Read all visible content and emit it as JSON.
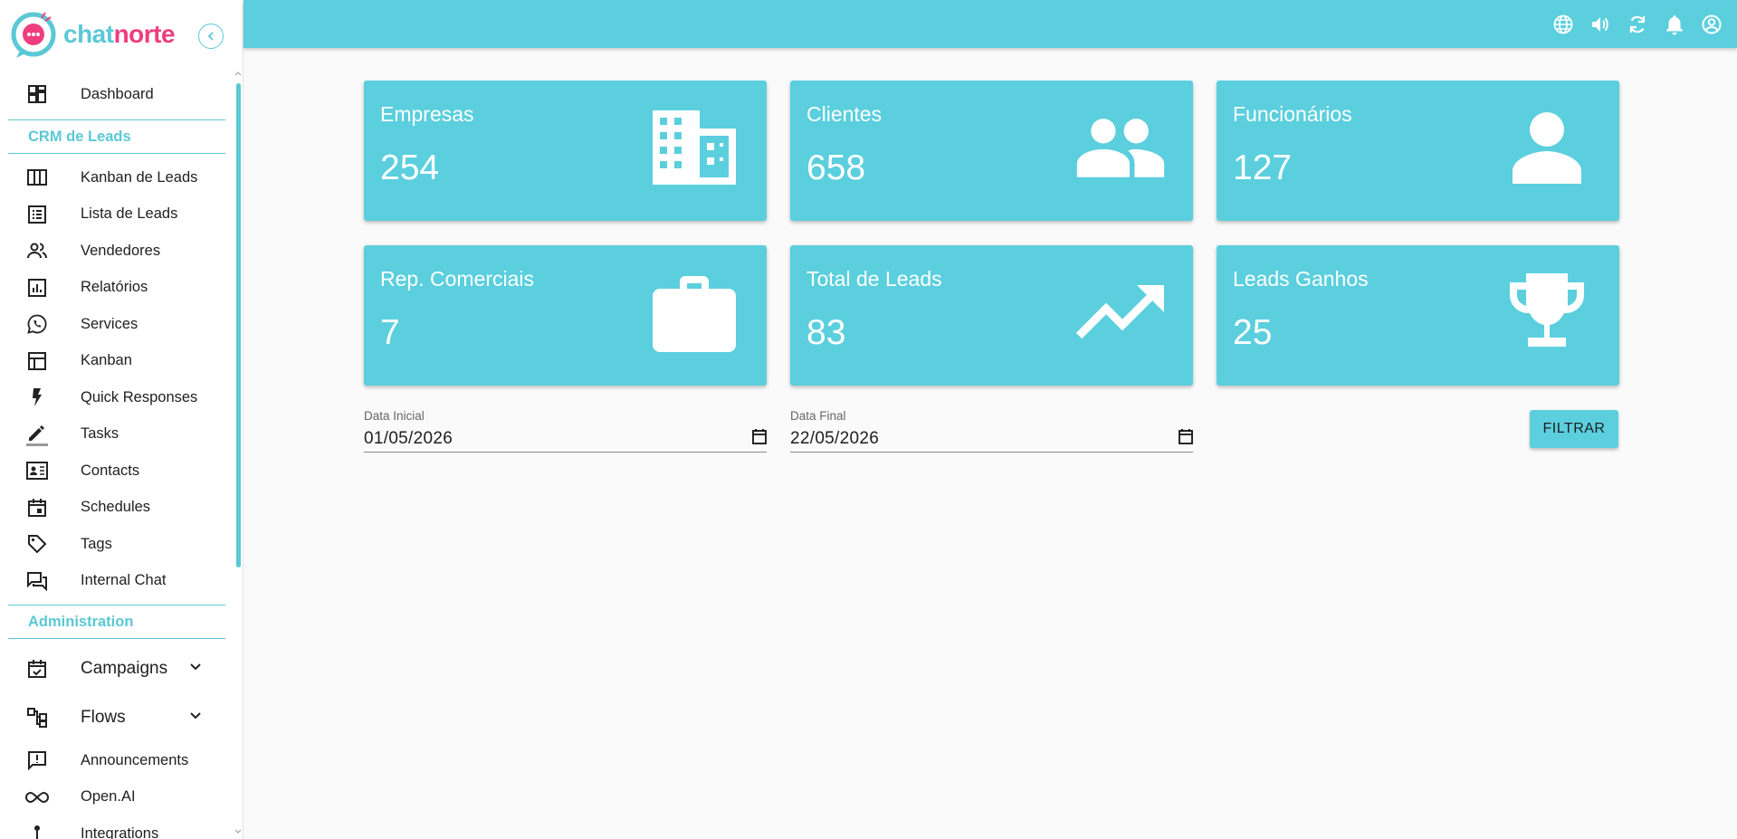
{
  "brand": {
    "name_part1": "chat",
    "name_part2": "norte"
  },
  "sidebar": {
    "items_top": [
      {
        "label": "Dashboard",
        "icon": "dashboard-icon"
      }
    ],
    "section_crm": "CRM de Leads",
    "items_crm": [
      {
        "label": "Kanban de Leads",
        "icon": "columns-icon"
      },
      {
        "label": "Lista de Leads",
        "icon": "list-icon"
      },
      {
        "label": "Vendedores",
        "icon": "people-icon"
      },
      {
        "label": "Relatórios",
        "icon": "report-icon"
      },
      {
        "label": "Services",
        "icon": "whatsapp-icon"
      },
      {
        "label": "Kanban",
        "icon": "table-icon"
      },
      {
        "label": "Quick Responses",
        "icon": "bolt-icon"
      },
      {
        "label": "Tasks",
        "icon": "pencil-icon"
      },
      {
        "label": "Contacts",
        "icon": "contact-card-icon"
      },
      {
        "label": "Schedules",
        "icon": "calendar-icon"
      },
      {
        "label": "Tags",
        "icon": "tag-icon"
      },
      {
        "label": "Internal Chat",
        "icon": "forum-icon"
      }
    ],
    "section_admin": "Administration",
    "items_admin": [
      {
        "label": "Campaigns",
        "icon": "event-check-icon"
      },
      {
        "label": "Flows",
        "icon": "flow-icon"
      },
      {
        "label": "Announcements",
        "icon": "announcement-icon"
      },
      {
        "label": "Open.AI",
        "icon": "infinity-icon"
      },
      {
        "label": "Integrations",
        "icon": "integration-icon"
      }
    ]
  },
  "topbar": {
    "icons": [
      "globe-icon",
      "volume-icon",
      "refresh-icon",
      "bell-icon",
      "account-icon"
    ]
  },
  "cards": [
    {
      "title": "Empresas",
      "value": "254",
      "icon": "building-icon"
    },
    {
      "title": "Clientes",
      "value": "658",
      "icon": "people-icon"
    },
    {
      "title": "Funcionários",
      "value": "127",
      "icon": "person-icon"
    },
    {
      "title": "Rep. Comerciais",
      "value": "7",
      "icon": "briefcase-icon"
    },
    {
      "title": "Total de Leads",
      "value": "83",
      "icon": "trending-up-icon"
    },
    {
      "title": "Leads Ganhos",
      "value": "25",
      "icon": "trophy-icon"
    }
  ],
  "filters": {
    "start_label": "Data Inicial",
    "start_value": "01/05/2026",
    "end_label": "Data Final",
    "end_value": "22/05/2026",
    "button_label": "FILTRAR"
  },
  "colors": {
    "accent": "#5bcfde",
    "brand_pink": "#ef3d7d"
  }
}
